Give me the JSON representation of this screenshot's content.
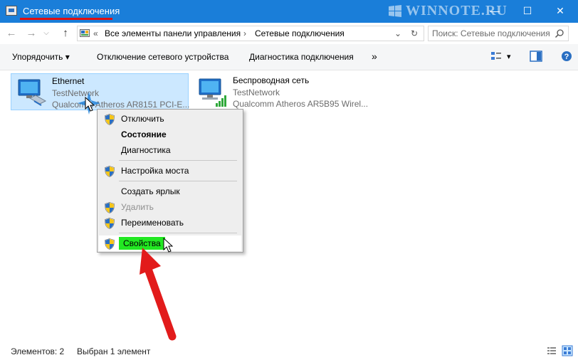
{
  "window": {
    "title": "Сетевые подключения",
    "minimize": "—",
    "maximize": "☐",
    "close": "✕",
    "watermark": "WINNOTE.RU"
  },
  "nav": {
    "back": "←",
    "forward": "→",
    "history": "⌵",
    "up": "↑",
    "address_prefix": "«",
    "breadcrumb": [
      "Все элементы панели управления",
      "Сетевые подключения"
    ],
    "breadcrumb_sep": "›",
    "dropdown": "⌄",
    "refresh": "↻",
    "search_placeholder": "Поиск: Сетевые подключения"
  },
  "commands": {
    "organize": "Упорядочить ▾",
    "disable_device": "Отключение сетевого устройства",
    "diagnose": "Диагностика подключения",
    "more": "»",
    "view_dropdown": "▾"
  },
  "connections": [
    {
      "name": "Ethernet",
      "network": "TestNetwork",
      "device": "Qualcomm Atheros AR8151 PCI-E...",
      "selected": true
    },
    {
      "name": "Беспроводная сеть",
      "network": "TestNetwork",
      "device": "Qualcomm Atheros AR5B95 Wirel...",
      "selected": false
    }
  ],
  "context_menu": {
    "items": [
      {
        "label": "Отключить",
        "shield": true
      },
      {
        "label": "Состояние",
        "bold": true
      },
      {
        "label": "Диагностика"
      },
      {
        "label": "Настройка моста",
        "shield": true
      },
      {
        "label": "Создать ярлык"
      },
      {
        "label": "Удалить",
        "shield": true,
        "disabled": true
      },
      {
        "label": "Переименовать",
        "shield": true
      },
      {
        "label": "Свойства",
        "shield": true,
        "highlighted": true
      }
    ]
  },
  "status": {
    "count": "Элементов: 2",
    "selected": "Выбран 1 элемент"
  },
  "colors": {
    "titlebar": "#1a7ed9",
    "selection": "#cce8ff",
    "highlight": "#22e822",
    "arrow": "#e21b1b"
  }
}
